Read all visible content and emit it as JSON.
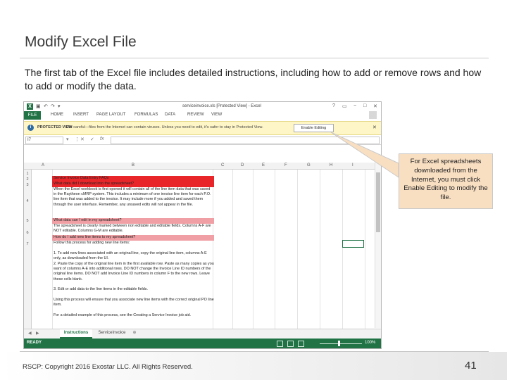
{
  "slide": {
    "title": "Modify Excel File",
    "body": "The first tab of the Excel file includes detailed instructions, including how to add or remove rows and how to add or modify the data.",
    "callout": "For Excel spreadsheets downloaded from the Internet, you must click Enable Editing to modify the file.",
    "footer": "RSCP: Copyright 2016 Exostar LLC. All Rights Reserved.",
    "page_number": "41"
  },
  "excel": {
    "window_title": "serviceinvoice.xls [Protected View] - Excel",
    "tabs": [
      "FILE",
      "HOME",
      "INSERT",
      "PAGE LAYOUT",
      "FORMULAS",
      "DATA",
      "REVIEW",
      "VIEW"
    ],
    "protected_view": {
      "label": "PROTECTED VIEW",
      "message": "Be careful—files from the Internet can contain viruses. Unless you need to edit, it's safer to stay in Protected View.",
      "button": "Enable Editing"
    },
    "name_box": "I7",
    "columns": [
      "A",
      "B",
      "C",
      "D",
      "E",
      "F",
      "G",
      "H",
      "I"
    ],
    "rows": [
      "1",
      "2",
      "3",
      "4",
      "5",
      "6",
      "7"
    ],
    "cells": {
      "r2": "Service Invoice Data Entry FAQs",
      "r3": "What data did I download into the spreadsheet?",
      "r4": "When the Excel workbook is first opened it will contain all of the line item data that was saved in the Raytheon cMRP system. This includes a minimum of one invoice line item for each P.O. line item that was added to the invoice. It may include more if you added and saved them through the user interface. Remember, any unsaved edits will not appear in the file.",
      "r5": "What data can I edit in my spreadsheet?",
      "r6": "The spreadsheet is clearly marked between non editable and editable fields. Columns A-F are NOT editable. Columns G-M are editable.",
      "r7": "How do I add new line items to my spreadsheet?",
      "r8": "Follow this process for adding new line items:",
      "r9": "1.  To add new lines associated with an original line, copy the original line item, columns A-E only, as downloaded from the UI.",
      "r10": "2.  Paste the copy of the original line item in the first available row. Paste as many copies as you want of columns A-E into additional rows. DO NOT change the Invoice Line ID numbers of the original line items. DO NOT add Invoice Line ID numbers in column F to the new rows. Leave these cells blank.",
      "r11": "3.  Edit or add data to the line items in the editable fields.",
      "r12": "Using this process will ensure that you associate new line items with the correct original PO line item.",
      "r13": "For a detailed example of this process, see the Creating a Service Invoice job aid."
    },
    "sheet_tabs": [
      "Instructions",
      "ServiceInvoice"
    ],
    "status": "READY",
    "zoom": "100%"
  }
}
